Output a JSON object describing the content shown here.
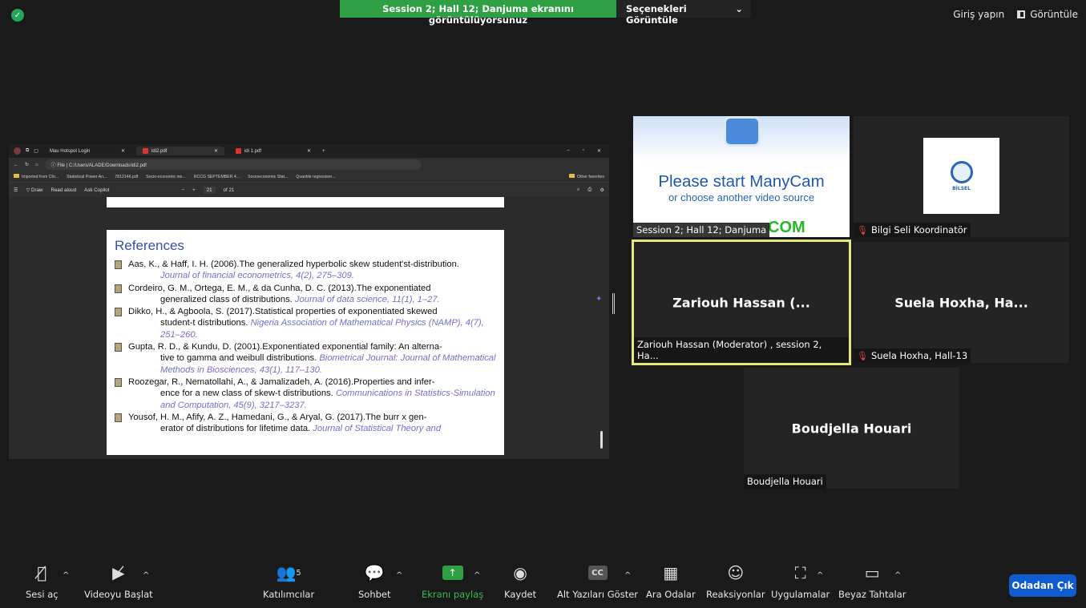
{
  "top": {
    "share_banner": "Session 2; Hall 12; Danjuma ekranını görüntülüyorsunuz",
    "view_options": "Seçenekleri Görüntüle",
    "view_options_caret": "⌄",
    "signin": "Giriş yapın",
    "view": "Görüntüle"
  },
  "browser": {
    "tabs": [
      {
        "label": "Mau Hotspot Login"
      },
      {
        "label": "idi2.pdf"
      },
      {
        "label": "idi 1.pdf"
      }
    ],
    "file_label": "File",
    "url": "C:/Users/ALADE/Downloads/idi2.pdf",
    "favorites": [
      "Imported from Chr...",
      "Statistical Power An...",
      "7812146.pdf",
      "Socio-economic ine...",
      "RCCG SEPTEMBER 4...",
      "Socioeconomic Stat...",
      "Quantile regression..."
    ],
    "other_favorites": "Other favorites",
    "pdf_toolbar": {
      "draw": "Draw",
      "read_aloud": "Read aloud",
      "ask_copilot": "Ask Copilot",
      "page": "21",
      "of_pages": "of 21"
    }
  },
  "pdf": {
    "title": "References",
    "refs": [
      {
        "line1": "Aas, K., & Haff, I. H. (2006).The generalized hyperbolic skew student'st-distribution.",
        "lines": [],
        "journal": "Journal of financial econometrics, 4(2), 275–309."
      },
      {
        "line1": "Cordeiro, G. M., Ortega, E. M., & da Cunha, D. C. (2013).The exponentiated",
        "lines": [
          "generalized class of distributions."
        ],
        "journal": "Journal of data science, 11(1), 1–27."
      },
      {
        "line1": "Dikko, H., & Agboola, S. (2017).Statistical properties of exponentiated skewed",
        "lines": [
          "student-t distributions."
        ],
        "journal": "Nigeria Association of Mathematical Physics (NAMP), 4(7), 251–260."
      },
      {
        "line1": "Gupta, R. D., & Kundu, D. (2001).Exponentiated exponential family: An alterna-",
        "lines": [
          "tive to gamma and weibull distributions."
        ],
        "journal": "Biometrical Journal: Journal of Mathematical Methods in Biosciences, 43(1), 117–130."
      },
      {
        "line1": "Roozegar, R., Nematollahi, A., & Jamalizadeh, A. (2016).Properties and infer-",
        "lines": [
          "ence for a new class of skew-t distributions."
        ],
        "journal": "Communications in Statistics-Simulation and Computation, 45(9), 3217–3237."
      },
      {
        "line1": "Yousof, H. M., Afify, A. Z., Hamedani, G., & Aryal, G. (2017).The burr x gen-",
        "lines": [
          "erator of distributions for lifetime data."
        ],
        "journal": "Journal of Statistical Theory and"
      }
    ]
  },
  "tiles": {
    "manycam": {
      "line1": "Please start ManyCam",
      "line2": "or choose another video source",
      "com": "COM",
      "label": "Session 2; Hall 12; Danjuma"
    },
    "bilsel": {
      "logo_text": "BİLSEL",
      "label": "Bilgi Seli Koordinatör"
    },
    "zariouh": {
      "name": "Zariouh Hassan (...",
      "label": "Zariouh Hassan (Moderator) , session 2, Ha..."
    },
    "suela": {
      "name": "Suela Hoxha, Ha...",
      "label": "Suela Hoxha, Hall-13"
    },
    "boudjella": {
      "name": "Boudjella Houari",
      "label": "Boudjella Houari"
    }
  },
  "toolbar": {
    "unmute": "Sesi aç",
    "start_video": "Videoyu Başlat",
    "participants": "Katılımcılar",
    "participants_count": "5",
    "chat": "Sohbet",
    "share": "Ekranı paylaş",
    "record": "Kaydet",
    "captions": "Alt Yazıları Göster",
    "captions_icon": "CC",
    "breakout": "Ara Odalar",
    "reactions": "Reaksiyonlar",
    "apps": "Uygulamalar",
    "whiteboard": "Beyaz Tahtalar",
    "leave": "Odadan Çık"
  }
}
